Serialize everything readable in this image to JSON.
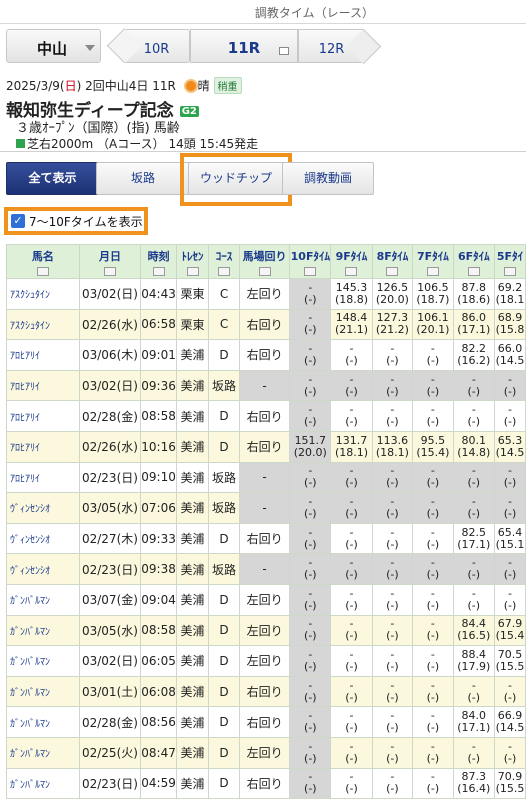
{
  "header": {
    "title": "調教タイム（レース）"
  },
  "race_nav": {
    "venue": "中山",
    "prev": "10R",
    "current": "11R",
    "next": "12R"
  },
  "race_info": {
    "date": "2025/3/9",
    "weekday": "日",
    "meeting": "2回中山4日",
    "race_no": "11R",
    "weather": "晴",
    "track_condition": "稍重",
    "name": "報知弥生ディープ記念",
    "grade": "G2",
    "conditions": "３歳ｵｰﾌﾟﾝ（国際）(指) 馬齢",
    "course": "芝右2000m （Aコース） 14頭 15:45発走"
  },
  "filters": [
    "全て表示",
    "坂路",
    "ウッドチップ",
    "調教動画"
  ],
  "checkbox": {
    "label": "7〜10Fタイムを表示",
    "checked": true
  },
  "table": {
    "columns": [
      "馬名",
      "月日",
      "時刻",
      "ﾄﾚｾﾝ",
      "ｺｰｽ",
      "馬場回り",
      "10Fﾀｲﾑ",
      "9Fﾀｲﾑ",
      "8Fﾀｲﾑ",
      "7Fﾀｲﾑ",
      "6Fﾀｲﾑ",
      "5Fﾀｲ"
    ],
    "rows": [
      {
        "horse": "ｱｽｸｼｭﾀｲﾝ",
        "date": "03/02(日)",
        "time": "04:43",
        "center": "栗東",
        "course": "C",
        "turn": "左回り",
        "t10": [
          "-",
          "(-)"
        ],
        "t9": [
          "145.3",
          "(18.8)"
        ],
        "t8": [
          "126.5",
          "(20.0)"
        ],
        "t7": [
          "106.5",
          "(18.7)"
        ],
        "t6": [
          "87.8",
          "(18.6)"
        ],
        "t5": [
          "69.2",
          "(18.1"
        ]
      },
      {
        "horse": "ｱｽｸｼｭﾀｲﾝ",
        "date": "02/26(水)",
        "time": "06:58",
        "center": "栗東",
        "course": "C",
        "turn": "右回り",
        "t10": [
          "-",
          "(-)"
        ],
        "t9": [
          "148.4",
          "(21.1)"
        ],
        "t8": [
          "127.3",
          "(21.2)"
        ],
        "t7": [
          "106.1",
          "(20.1)"
        ],
        "t6": [
          "86.0",
          "(17.1)"
        ],
        "t5": [
          "68.9",
          "(15.8"
        ]
      },
      {
        "horse": "ｱﾛﾋｱﾘｲ",
        "date": "03/06(木)",
        "time": "09:01",
        "center": "美浦",
        "course": "D",
        "turn": "右回り",
        "t10": [
          "-",
          "(-)"
        ],
        "t9": [
          "-",
          "(-)"
        ],
        "t8": [
          "-",
          "(-)"
        ],
        "t7": [
          "-",
          "(-)"
        ],
        "t6": [
          "82.2",
          "(16.2)"
        ],
        "t5": [
          "66.0",
          "(14.5"
        ]
      },
      {
        "horse": "ｱﾛﾋｱﾘｲ",
        "date": "03/02(日)",
        "time": "09:36",
        "center": "美浦",
        "course": "坂路",
        "turn": "-",
        "t10": [
          "-",
          "(-)"
        ],
        "t9": [
          "-",
          "(-)"
        ],
        "t8": [
          "-",
          "(-)"
        ],
        "t7": [
          "-",
          "(-)"
        ],
        "t6": [
          "-",
          "(-)"
        ],
        "t5": [
          "-",
          "(-)"
        ]
      },
      {
        "horse": "ｱﾛﾋｱﾘｲ",
        "date": "02/28(金)",
        "time": "08:58",
        "center": "美浦",
        "course": "D",
        "turn": "右回り",
        "t10": [
          "-",
          "(-)"
        ],
        "t9": [
          "-",
          "(-)"
        ],
        "t8": [
          "-",
          "(-)"
        ],
        "t7": [
          "-",
          "(-)"
        ],
        "t6": [
          "-",
          "(-)"
        ],
        "t5": [
          "-",
          "(-)"
        ]
      },
      {
        "horse": "ｱﾛﾋｱﾘｲ",
        "date": "02/26(水)",
        "time": "10:16",
        "center": "美浦",
        "course": "D",
        "turn": "右回り",
        "t10": [
          "151.7",
          "(20.0)"
        ],
        "t9": [
          "131.7",
          "(18.1)"
        ],
        "t8": [
          "113.6",
          "(18.1)"
        ],
        "t7": [
          "95.5",
          "(15.4)"
        ],
        "t6": [
          "80.1",
          "(14.8)"
        ],
        "t5": [
          "65.3",
          "(14.5"
        ]
      },
      {
        "horse": "ｱﾛﾋｱﾘｲ",
        "date": "02/23(日)",
        "time": "09:10",
        "center": "美浦",
        "course": "坂路",
        "turn": "-",
        "t10": [
          "-",
          "(-)"
        ],
        "t9": [
          "-",
          "(-)"
        ],
        "t8": [
          "-",
          "(-)"
        ],
        "t7": [
          "-",
          "(-)"
        ],
        "t6": [
          "-",
          "(-)"
        ],
        "t5": [
          "-",
          "(-)"
        ]
      },
      {
        "horse": "ｳﾞｨﾝｾﾝｼｵ",
        "date": "03/05(水)",
        "time": "07:06",
        "center": "美浦",
        "course": "坂路",
        "turn": "-",
        "t10": [
          "-",
          "(-)"
        ],
        "t9": [
          "-",
          "(-)"
        ],
        "t8": [
          "-",
          "(-)"
        ],
        "t7": [
          "-",
          "(-)"
        ],
        "t6": [
          "-",
          "(-)"
        ],
        "t5": [
          "-",
          "(-)"
        ]
      },
      {
        "horse": "ｳﾞｨﾝｾﾝｼｵ",
        "date": "02/27(木)",
        "time": "09:33",
        "center": "美浦",
        "course": "D",
        "turn": "右回り",
        "t10": [
          "-",
          "(-)"
        ],
        "t9": [
          "-",
          "(-)"
        ],
        "t8": [
          "-",
          "(-)"
        ],
        "t7": [
          "-",
          "(-)"
        ],
        "t6": [
          "82.5",
          "(17.1)"
        ],
        "t5": [
          "65.4",
          "(15.1"
        ]
      },
      {
        "horse": "ｳﾞｨﾝｾﾝｼｵ",
        "date": "02/23(日)",
        "time": "09:38",
        "center": "美浦",
        "course": "坂路",
        "turn": "-",
        "t10": [
          "-",
          "(-)"
        ],
        "t9": [
          "-",
          "(-)"
        ],
        "t8": [
          "-",
          "(-)"
        ],
        "t7": [
          "-",
          "(-)"
        ],
        "t6": [
          "-",
          "(-)"
        ],
        "t5": [
          "-",
          "(-)"
        ]
      },
      {
        "horse": "ｶﾞﾝﾊﾞﾙﾏﾝ",
        "date": "03/07(金)",
        "time": "09:04",
        "center": "美浦",
        "course": "D",
        "turn": "左回り",
        "t10": [
          "-",
          "(-)"
        ],
        "t9": [
          "-",
          "(-)"
        ],
        "t8": [
          "-",
          "(-)"
        ],
        "t7": [
          "-",
          "(-)"
        ],
        "t6": [
          "-",
          "(-)"
        ],
        "t5": [
          "-",
          "(-)"
        ]
      },
      {
        "horse": "ｶﾞﾝﾊﾞﾙﾏﾝ",
        "date": "03/05(水)",
        "time": "08:58",
        "center": "美浦",
        "course": "D",
        "turn": "左回り",
        "t10": [
          "-",
          "(-)"
        ],
        "t9": [
          "-",
          "(-)"
        ],
        "t8": [
          "-",
          "(-)"
        ],
        "t7": [
          "-",
          "(-)"
        ],
        "t6": [
          "84.4",
          "(16.5)"
        ],
        "t5": [
          "67.9",
          "(15.4"
        ]
      },
      {
        "horse": "ｶﾞﾝﾊﾞﾙﾏﾝ",
        "date": "03/02(日)",
        "time": "06:05",
        "center": "美浦",
        "course": "D",
        "turn": "左回り",
        "t10": [
          "-",
          "(-)"
        ],
        "t9": [
          "-",
          "(-)"
        ],
        "t8": [
          "-",
          "(-)"
        ],
        "t7": [
          "-",
          "(-)"
        ],
        "t6": [
          "88.4",
          "(17.9)"
        ],
        "t5": [
          "70.5",
          "(15.5"
        ]
      },
      {
        "horse": "ｶﾞﾝﾊﾞﾙﾏﾝ",
        "date": "03/01(土)",
        "time": "06:08",
        "center": "美浦",
        "course": "D",
        "turn": "右回り",
        "t10": [
          "-",
          "(-)"
        ],
        "t9": [
          "-",
          "(-)"
        ],
        "t8": [
          "-",
          "(-)"
        ],
        "t7": [
          "-",
          "(-)"
        ],
        "t6": [
          "-",
          "(-)"
        ],
        "t5": [
          "-",
          "(-)"
        ]
      },
      {
        "horse": "ｶﾞﾝﾊﾞﾙﾏﾝ",
        "date": "02/28(金)",
        "time": "08:56",
        "center": "美浦",
        "course": "D",
        "turn": "右回り",
        "t10": [
          "-",
          "(-)"
        ],
        "t9": [
          "-",
          "(-)"
        ],
        "t8": [
          "-",
          "(-)"
        ],
        "t7": [
          "-",
          "(-)"
        ],
        "t6": [
          "84.0",
          "(17.1)"
        ],
        "t5": [
          "66.9",
          "(14.5"
        ]
      },
      {
        "horse": "ｶﾞﾝﾊﾞﾙﾏﾝ",
        "date": "02/25(火)",
        "time": "08:47",
        "center": "美浦",
        "course": "D",
        "turn": "左回り",
        "t10": [
          "-",
          "(-)"
        ],
        "t9": [
          "-",
          "(-)"
        ],
        "t8": [
          "-",
          "(-)"
        ],
        "t7": [
          "-",
          "(-)"
        ],
        "t6": [
          "-",
          "(-)"
        ],
        "t5": [
          "-",
          "(-)"
        ]
      },
      {
        "horse": "ｶﾞﾝﾊﾞﾙﾏﾝ",
        "date": "02/23(日)",
        "time": "04:59",
        "center": "美浦",
        "course": "D",
        "turn": "右回り",
        "t10": [
          "-",
          "(-)"
        ],
        "t9": [
          "-",
          "(-)"
        ],
        "t8": [
          "-",
          "(-)"
        ],
        "t7": [
          "-",
          "(-)"
        ],
        "t6": [
          "87.3",
          "(16.4)"
        ],
        "t5": [
          "70.9",
          "(15.5"
        ]
      }
    ]
  },
  "colors": {
    "accent_orange": "#f0921e",
    "nav_blue": "#1b3a8c",
    "header_green": "#dff0d8",
    "row_alt": "#fbf8dd",
    "gray_cell": "#d6d6d6"
  }
}
